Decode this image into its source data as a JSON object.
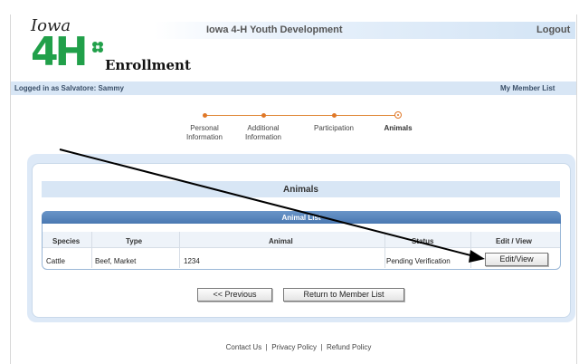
{
  "header": {
    "site_title": "Iowa 4-H Youth Development",
    "logout_label": "Logout",
    "logo": {
      "top_text": "Iowa",
      "mark": "4H",
      "word": "Enrollment",
      "icon": "clover-icon"
    }
  },
  "user_bar": {
    "logged_in_text": "Logged in as Salvatore: Sammy",
    "my_member_list": "My Member List"
  },
  "steps": [
    {
      "line1": "Personal",
      "line2": "Information",
      "current": false
    },
    {
      "line1": "Additional",
      "line2": "Information",
      "current": false
    },
    {
      "line1": "Participation",
      "line2": "",
      "current": false
    },
    {
      "line1": "Animals",
      "line2": "",
      "current": true
    }
  ],
  "main": {
    "section_title": "Animals",
    "list_title": "Animal List",
    "columns": [
      "Species",
      "Type",
      "Animal",
      "Status",
      "Edit / View"
    ],
    "rows": [
      {
        "species": "Cattle",
        "type": "Beef, Market",
        "animal": "1234",
        "status": "Pending Verification",
        "action": "Edit/View"
      }
    ],
    "previous_label": "<< Previous",
    "return_label": "Return to Member List"
  },
  "footer": {
    "contact": "Contact Us",
    "privacy": "Privacy Policy",
    "refund": "Refund Policy",
    "separator": "|"
  },
  "colors": {
    "accent_orange": "#e07828",
    "list_header_blue": "#4a78b2",
    "bar_blue": "#d8e6f5",
    "logo_green": "#21a04a"
  }
}
